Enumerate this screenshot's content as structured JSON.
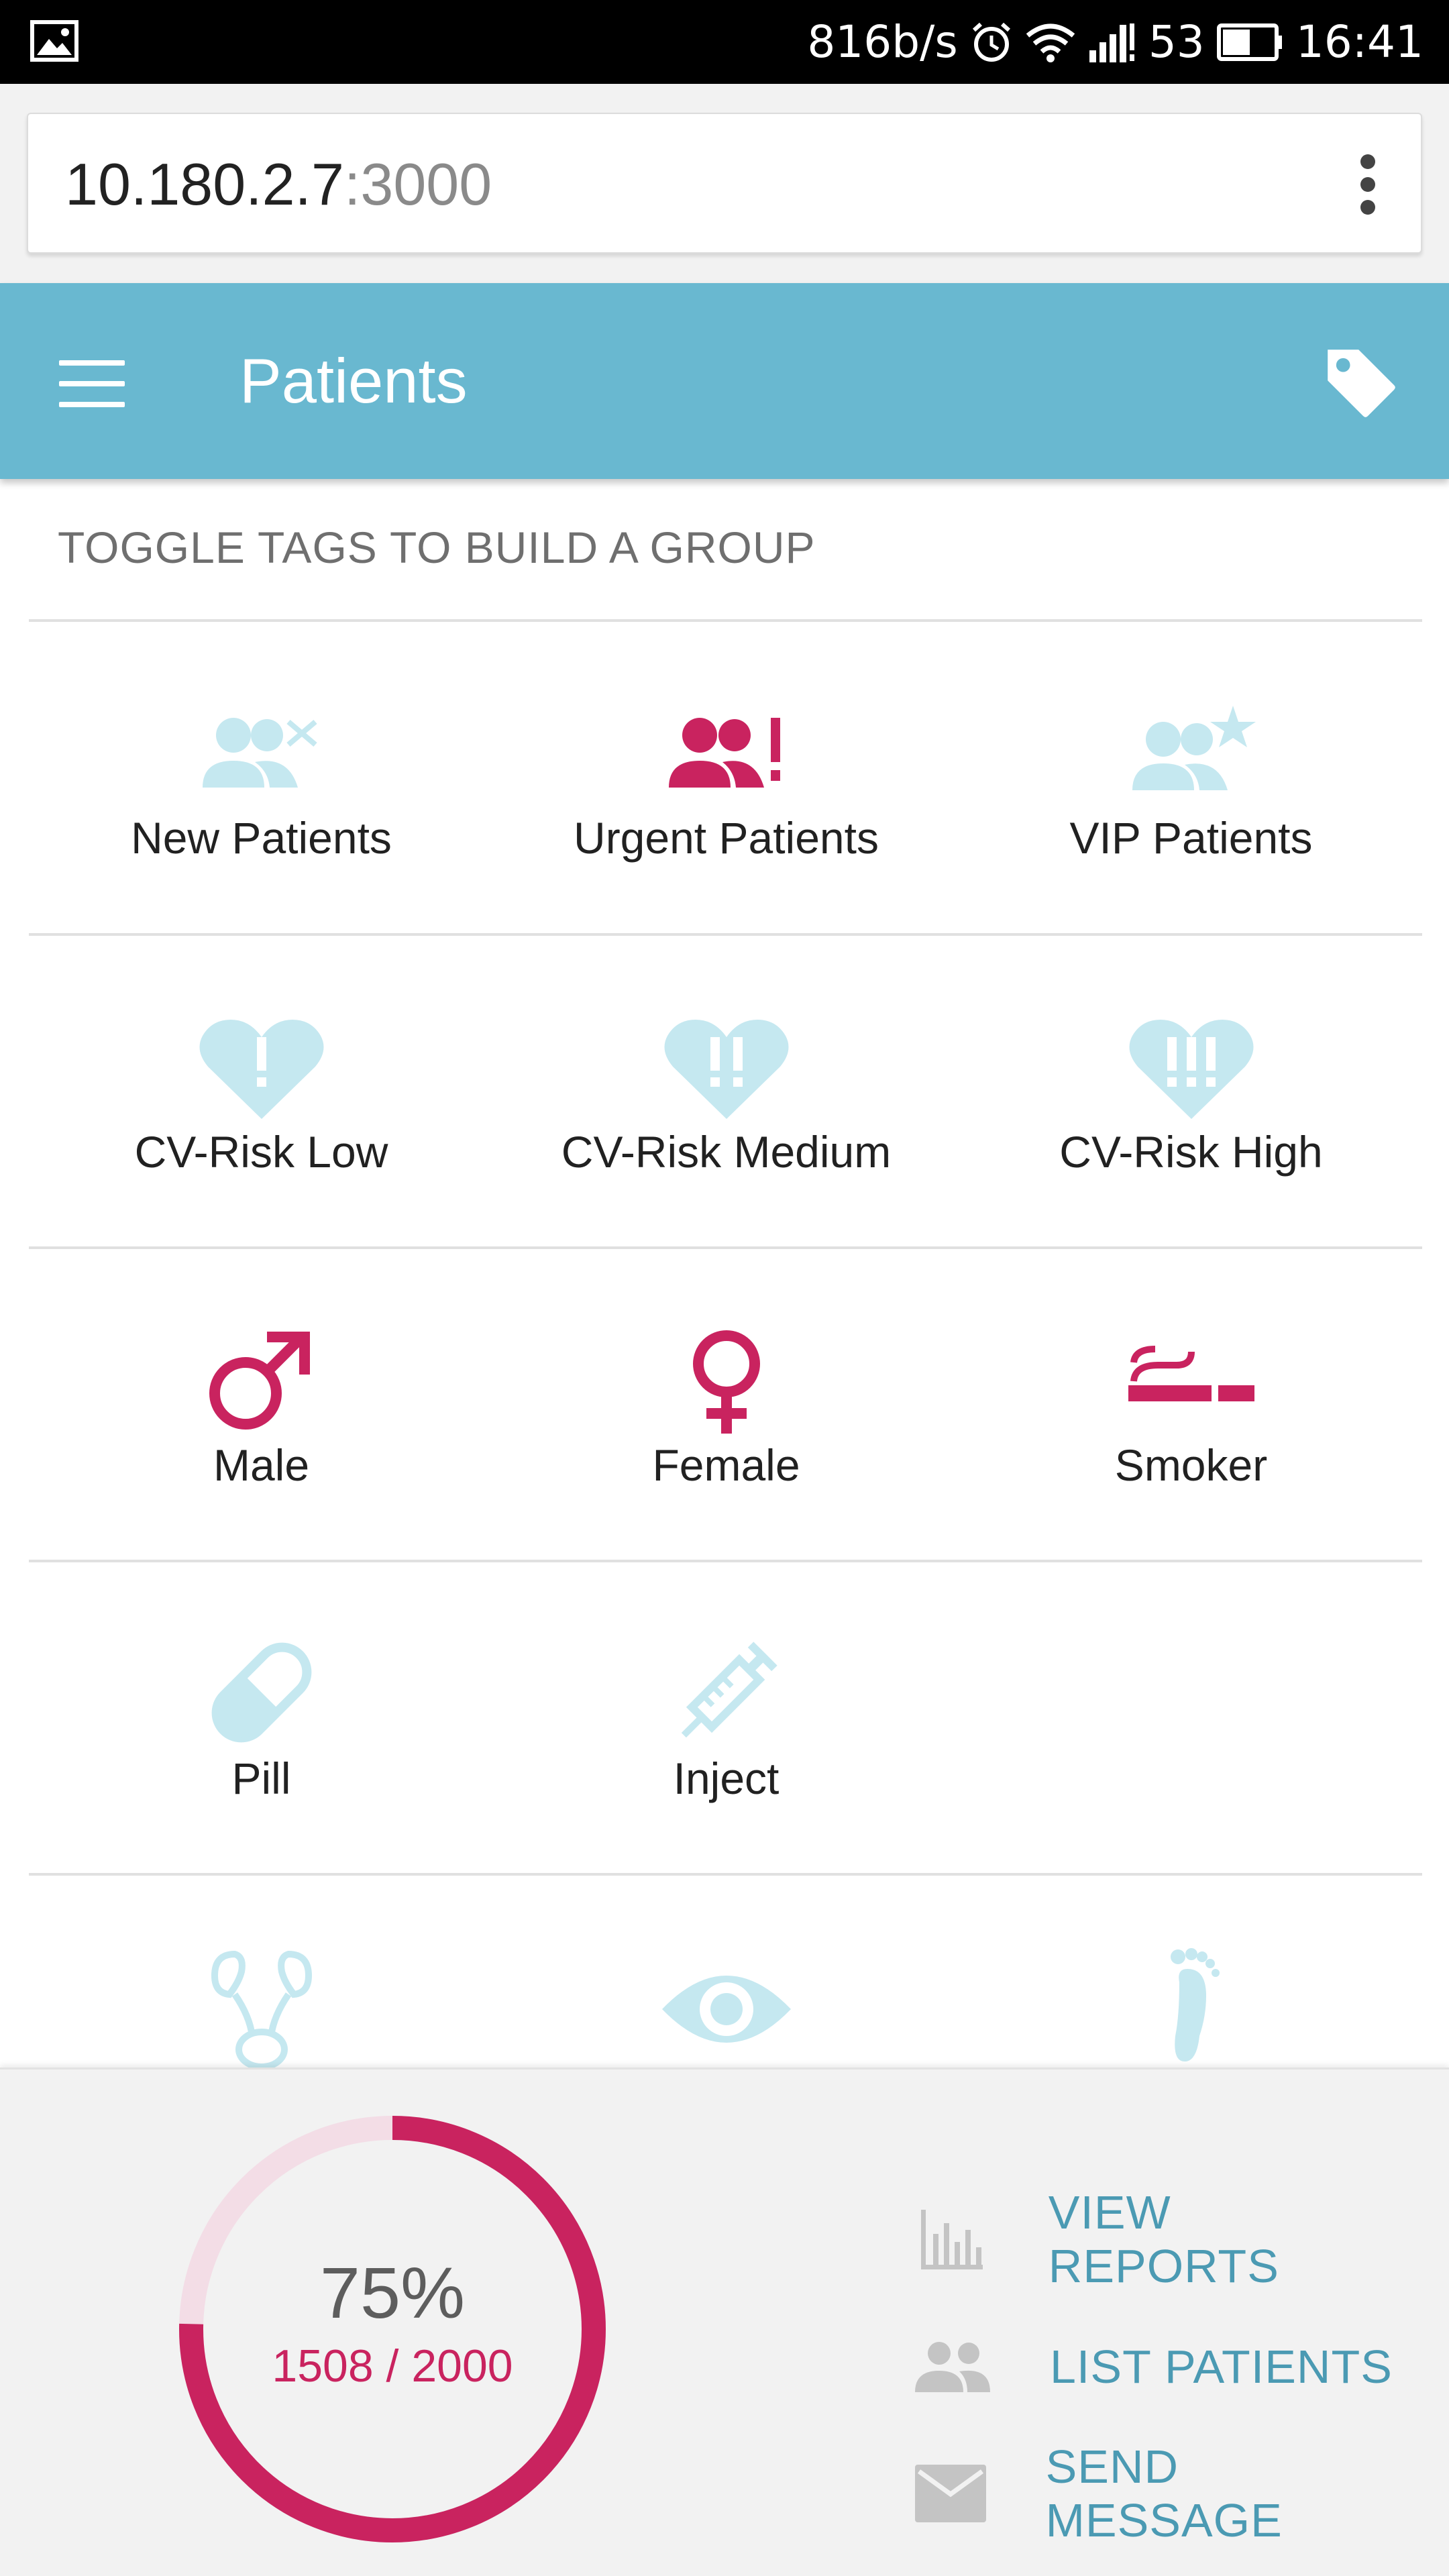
{
  "status_bar": {
    "net_speed": "816b/s",
    "battery": "53",
    "time": "16:41",
    "icons": [
      "image-icon",
      "alarm-icon",
      "wifi-icon",
      "signal-icon",
      "battery-icon"
    ]
  },
  "browser": {
    "url_host": "10.180.2.7",
    "url_port": ":3000",
    "menu_icon": "more-vert-icon"
  },
  "app_bar": {
    "title": "Patients",
    "menu_icon": "hamburger-icon",
    "action_icon": "tag-icon",
    "color": "#69b8d0"
  },
  "subheader": "TOGGLE TAGS TO BUILD A GROUP",
  "tags": [
    {
      "label": "New Patients",
      "icon": "new-patients-icon",
      "active": false
    },
    {
      "label": "Urgent Patients",
      "icon": "urgent-patients-icon",
      "active": true
    },
    {
      "label": "VIP Patients",
      "icon": "vip-patients-icon",
      "active": false
    },
    {
      "label": "CV-Risk Low",
      "icon": "heart-low-icon",
      "active": false
    },
    {
      "label": "CV-Risk Medium",
      "icon": "heart-medium-icon",
      "active": false
    },
    {
      "label": "CV-Risk High",
      "icon": "heart-high-icon",
      "active": false
    },
    {
      "label": "Male",
      "icon": "male-icon",
      "active": true
    },
    {
      "label": "Female",
      "icon": "female-icon",
      "active": true
    },
    {
      "label": "Smoker",
      "icon": "smoker-icon",
      "active": true
    },
    {
      "label": "Pill",
      "icon": "pill-icon",
      "active": false
    },
    {
      "label": "Inject",
      "icon": "syringe-icon",
      "active": false
    },
    {
      "label": "",
      "icon": "kidney-icon",
      "active": false
    },
    {
      "label": "",
      "icon": "eye-icon",
      "active": false
    },
    {
      "label": "",
      "icon": "foot-icon",
      "active": false
    }
  ],
  "colors": {
    "active": "#c9235f",
    "inactive": "#c5e8f0",
    "accent_text": "#4b9ab3"
  },
  "summary": {
    "percent_label": "75%",
    "count_label": "1508 / 2000",
    "progress": 0.754
  },
  "actions": [
    {
      "label": "VIEW REPORTS",
      "icon": "bar-chart-icon"
    },
    {
      "label": "LIST PATIENTS",
      "icon": "people-icon"
    },
    {
      "label": "SEND MESSAGE",
      "icon": "mail-icon"
    }
  ]
}
